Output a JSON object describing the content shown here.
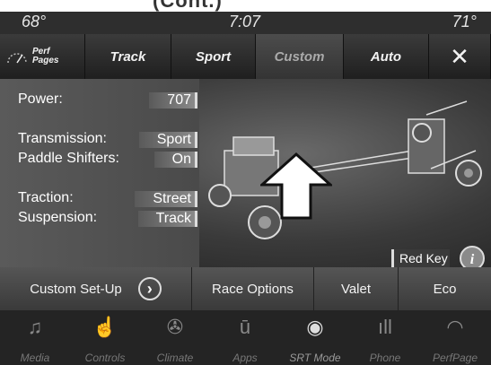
{
  "header_partial": "(Cont.)",
  "status_bar": {
    "outside_temp": "68°",
    "time": "7:07",
    "inside_temp": "71°"
  },
  "tabs": [
    {
      "label_line1": "Perf",
      "label_line2": "Pages"
    },
    {
      "label": "Track"
    },
    {
      "label": "Sport"
    },
    {
      "label": "Custom"
    },
    {
      "label": "Auto"
    },
    {
      "label": "✕"
    }
  ],
  "settings": {
    "power_label": "Power:",
    "power_value": "707",
    "transmission_label": "Transmission:",
    "transmission_value": "Sport",
    "paddle_label": "Paddle Shifters:",
    "paddle_value": "On",
    "traction_label": "Traction:",
    "traction_value": "Street",
    "suspension_label": "Suspension:",
    "suspension_value": "Track"
  },
  "red_key": "Red Key",
  "info_icon": "i",
  "bottom_buttons": {
    "custom_setup": "Custom Set-Up",
    "race_options": "Race Options",
    "valet": "Valet",
    "eco": "Eco"
  },
  "nav": [
    {
      "label": "Media",
      "icon": "music-note-icon"
    },
    {
      "label": "Controls",
      "icon": "controls-hand-icon"
    },
    {
      "label": "Climate",
      "icon": "climate-fan-icon"
    },
    {
      "label": "Apps",
      "icon": "apps-icon"
    },
    {
      "label": "SRT Mode",
      "icon": "steering-wheel-icon"
    },
    {
      "label": "Phone",
      "icon": "phone-bluetooth-icon"
    },
    {
      "label": "PerfPage",
      "icon": "gauge-icon"
    }
  ]
}
